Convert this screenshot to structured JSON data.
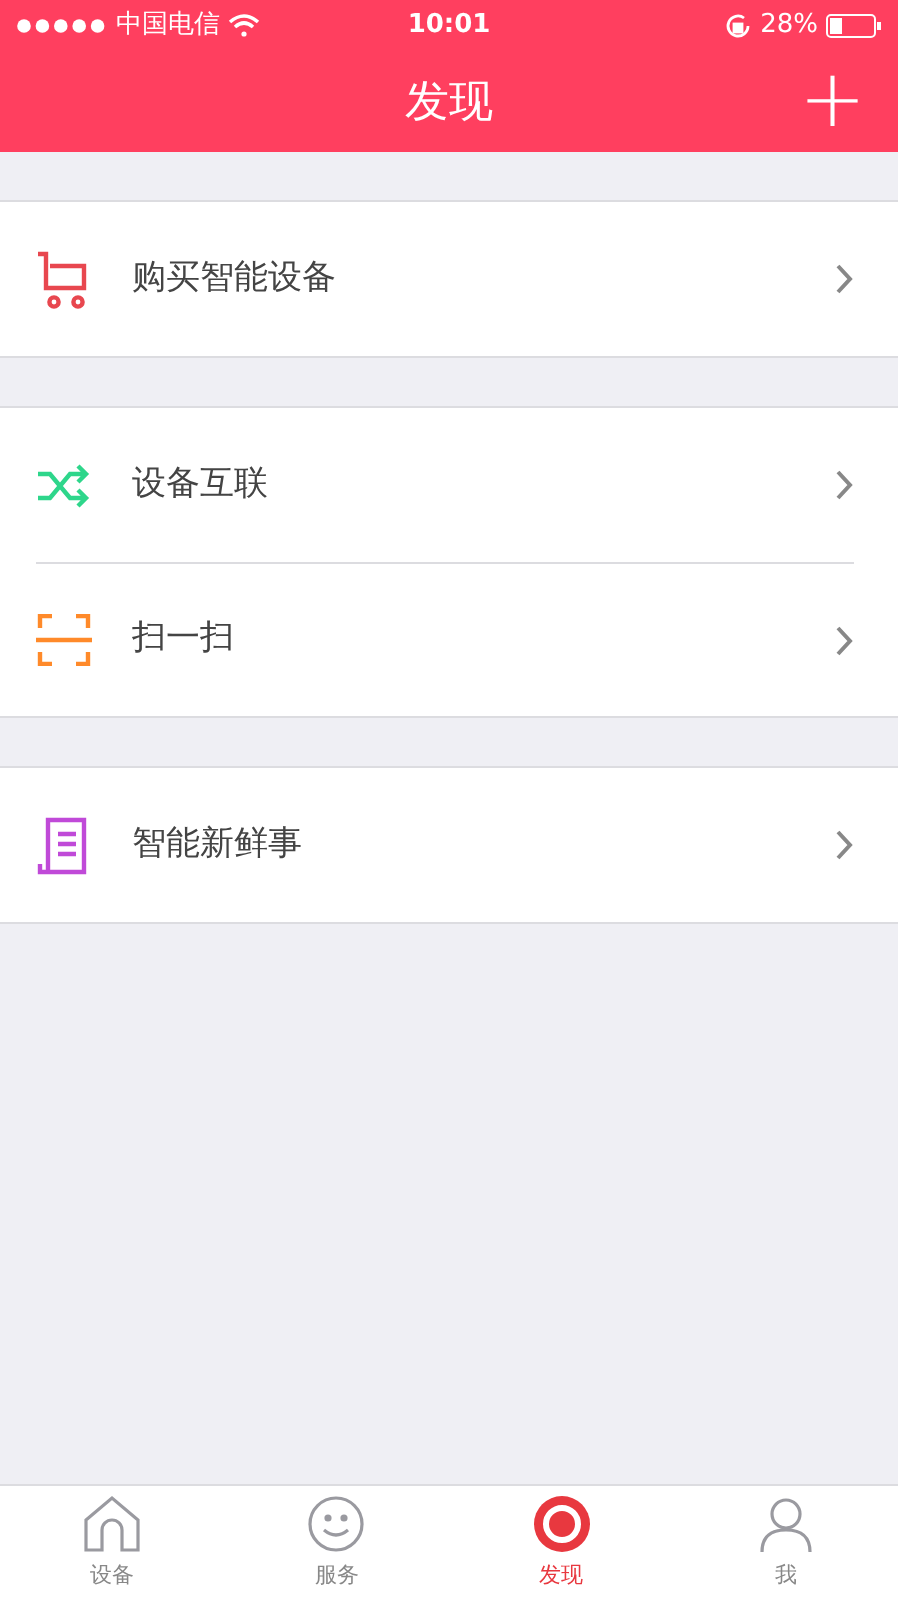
{
  "status_bar": {
    "carrier": "中国电信",
    "time": "10:01",
    "battery": "28%"
  },
  "nav_bar": {
    "title": "发现",
    "action": "+"
  },
  "groups": [
    {
      "items": [
        {
          "kind": "cart",
          "label": "购买智能设备"
        }
      ]
    },
    {
      "items": [
        {
          "kind": "shuffle",
          "label": "设备互联"
        },
        {
          "kind": "scan",
          "label": "扫一扫"
        }
      ]
    },
    {
      "items": [
        {
          "kind": "news",
          "label": "智能新鲜事"
        }
      ]
    }
  ],
  "tab_bar": [
    {
      "kind": "home",
      "label": "设备",
      "selected": false
    },
    {
      "kind": "smile",
      "label": "服务",
      "selected": false
    },
    {
      "kind": "discover",
      "label": "发现",
      "selected": true
    },
    {
      "kind": "person",
      "label": "我",
      "selected": false
    }
  ]
}
